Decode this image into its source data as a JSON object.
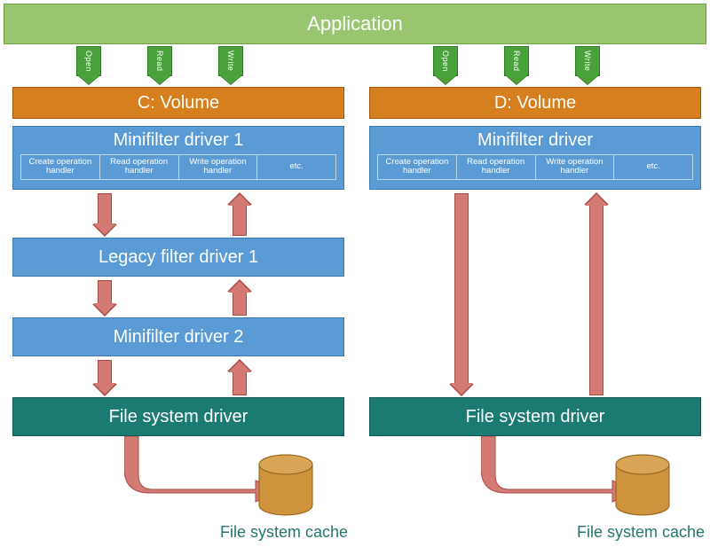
{
  "app_label": "Application",
  "ops": {
    "open": "Open",
    "read": "Read",
    "write": "Write"
  },
  "left": {
    "volume": "C: Volume",
    "minifilter1_title": "Minifilter driver 1",
    "legacy": "Legacy filter driver 1",
    "minifilter2": "Minifilter driver 2",
    "fs": "File system driver",
    "cache": "File system cache"
  },
  "right": {
    "volume": "D: Volume",
    "minifilter_title": "Minifilter driver",
    "fs": "File system driver",
    "cache": "File system cache"
  },
  "handlers": {
    "create": "Create operation handler",
    "read": "Read operation handler",
    "write": "Write operation handler",
    "etc": "etc."
  },
  "colors": {
    "app": "#99c572",
    "volume": "#d67f1e",
    "driver": "#5b9bd5",
    "fs": "#1b7b73",
    "red_arrow": "#d47a74",
    "green_arrow": "#4aa03a",
    "cache_cylinder": "#cf933d"
  }
}
